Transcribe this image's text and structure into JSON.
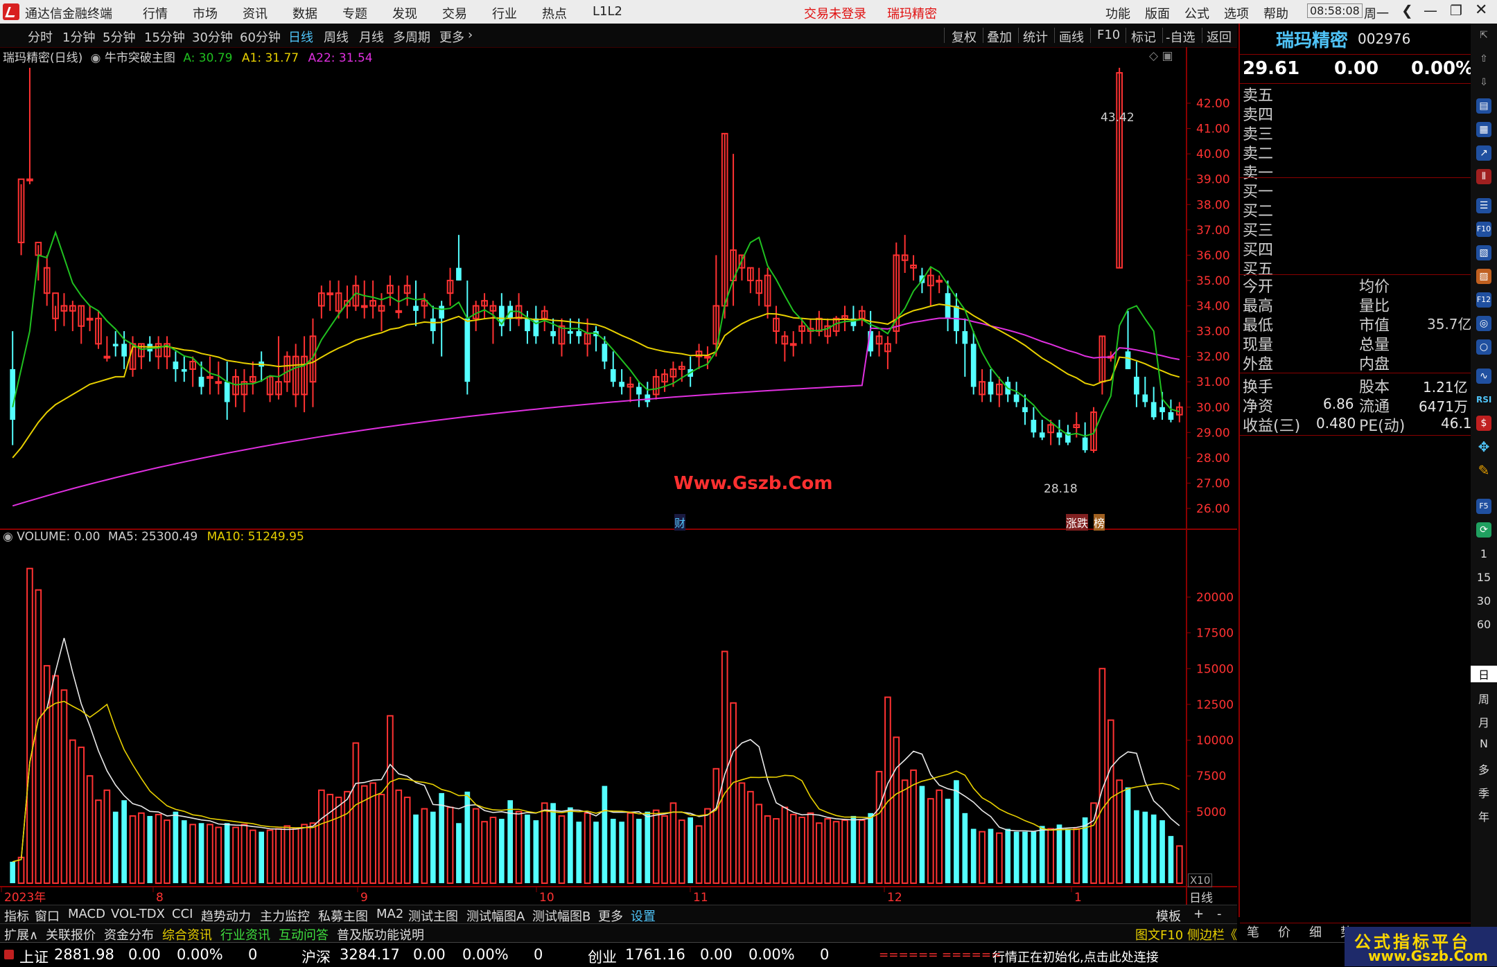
{
  "app": {
    "title": "通达信金融终端",
    "menu": [
      "行情",
      "市场",
      "资讯",
      "数据",
      "专题",
      "发现",
      "交易",
      "行业",
      "热点",
      "L1L2"
    ],
    "login_status": "交易未登录",
    "stock_name": "瑞玛精密",
    "right_menu": [
      "功能",
      "版面",
      "公式",
      "选项",
      "帮助"
    ],
    "time": "08:58:08",
    "weekday": "周一"
  },
  "period_bar": {
    "periods": [
      "分时",
      "1分钟",
      "5分钟",
      "15分钟",
      "30分钟",
      "60分钟",
      "日线",
      "周线",
      "月线",
      "多周期",
      "更多"
    ],
    "active": "日线",
    "tools": [
      "复权",
      "叠加",
      "统计",
      "画线",
      "F10",
      "标记",
      "-自选",
      "返回"
    ]
  },
  "main_chart": {
    "title": "瑞玛精密(日线)",
    "indicator": "牛市突破主图",
    "a_label": "A: 30.79",
    "a1_label": "A1: 31.77",
    "a22_label": "A22: 31.54",
    "y_ticks": [
      "42.00",
      "41.00",
      "40.00",
      "39.00",
      "38.00",
      "37.00",
      "36.00",
      "35.00",
      "34.00",
      "33.00",
      "32.00",
      "31.00",
      "30.00",
      "29.00",
      "28.00",
      "27.00",
      "26.00"
    ],
    "high_label": "43.42",
    "low_label": "28.18",
    "watermark": "Www.Gszb.Com",
    "marker_cai": "财",
    "marker_zhangdie": "涨跌",
    "marker_bang": "榜"
  },
  "volume_chart": {
    "title": "VOLUME: 0.00",
    "ma5_label": "MA5: 25300.49",
    "ma10_label": "MA10: 51249.95",
    "y_ticks": [
      "20000",
      "17500",
      "15000",
      "12500",
      "10000",
      "7500",
      "5000"
    ],
    "unit": "X10",
    "x_labels": [
      "2023年",
      "8",
      "9",
      "10",
      "11",
      "12",
      "1"
    ],
    "period_label": "日线"
  },
  "chart_data": {
    "type": "candlestick",
    "price_axis": [
      26.0,
      43.0
    ],
    "candles": [
      [
        31.5,
        33.0,
        28.5,
        29.5
      ],
      [
        36.5,
        38.8,
        36.0,
        39.0
      ],
      [
        39.0,
        43.4,
        38.8,
        39.0
      ],
      [
        36.0,
        36.4,
        35.0,
        36.5
      ],
      [
        34.5,
        36.0,
        34.0,
        35.5
      ],
      [
        33.5,
        34.0,
        33.0,
        34.5
      ],
      [
        33.8,
        34.5,
        33.2,
        34.0
      ],
      [
        33.8,
        34.2,
        33.0,
        34.0
      ],
      [
        33.2,
        34.0,
        32.5,
        34.0
      ],
      [
        33.5,
        34.0,
        33.0,
        33.5
      ],
      [
        32.5,
        33.8,
        32.3,
        33.5
      ],
      [
        32.0,
        32.8,
        31.8,
        32.0
      ],
      [
        32.5,
        33.0,
        32.0,
        32.4
      ],
      [
        32.5,
        33.0,
        31.5,
        32.0
      ],
      [
        31.5,
        32.8,
        31.2,
        32.5
      ],
      [
        32.0,
        32.5,
        31.5,
        32.5
      ],
      [
        32.5,
        32.8,
        31.8,
        32.2
      ],
      [
        32.0,
        32.8,
        31.5,
        32.5
      ],
      [
        32.0,
        32.8,
        31.5,
        32.5
      ],
      [
        31.8,
        32.2,
        31.0,
        31.5
      ],
      [
        31.5,
        32.0,
        31.0,
        31.4
      ],
      [
        31.5,
        32.0,
        30.8,
        31.8
      ],
      [
        31.2,
        31.8,
        30.5,
        30.8
      ],
      [
        31.2,
        32.0,
        30.5,
        31.2
      ],
      [
        31.0,
        31.8,
        30.5,
        31.0
      ],
      [
        31.0,
        31.8,
        29.5,
        30.2
      ],
      [
        30.5,
        31.5,
        30.0,
        31.2
      ],
      [
        30.5,
        31.5,
        29.8,
        31.0
      ],
      [
        31.0,
        31.8,
        30.5,
        31.2
      ],
      [
        31.8,
        32.2,
        31.0,
        31.6
      ],
      [
        30.5,
        31.2,
        30.2,
        31.2
      ],
      [
        30.5,
        32.8,
        30.3,
        31.0
      ],
      [
        31.0,
        32.2,
        30.6,
        32.0
      ],
      [
        30.5,
        32.5,
        30.0,
        32.0
      ],
      [
        30.5,
        32.8,
        29.8,
        32.0
      ],
      [
        31.0,
        33.5,
        30.0,
        32.8
      ],
      [
        34.0,
        34.8,
        33.5,
        34.5
      ],
      [
        34.5,
        35.0,
        33.8,
        34.5
      ],
      [
        33.8,
        35.0,
        33.5,
        34.5
      ],
      [
        34.0,
        34.8,
        33.5,
        34.2
      ],
      [
        34.0,
        35.2,
        33.8,
        34.8
      ],
      [
        34.0,
        35.0,
        33.5,
        34.0
      ],
      [
        34.0,
        35.0,
        33.5,
        34.2
      ],
      [
        33.8,
        34.5,
        33.0,
        34.0
      ],
      [
        34.5,
        35.2,
        34.0,
        34.8
      ],
      [
        33.8,
        34.8,
        33.5,
        33.8
      ],
      [
        34.5,
        35.2,
        34.0,
        34.8
      ],
      [
        34.0,
        35.0,
        33.2,
        33.8
      ],
      [
        34.0,
        34.5,
        33.5,
        34.2
      ],
      [
        33.5,
        34.0,
        32.5,
        33.0
      ],
      [
        34.0,
        34.2,
        32.0,
        33.5
      ],
      [
        34.5,
        35.5,
        34.0,
        35.0
      ],
      [
        35.5,
        36.8,
        35.0,
        35.0
      ],
      [
        33.5,
        35.0,
        30.5,
        31.0
      ],
      [
        33.5,
        34.2,
        33.0,
        34.0
      ],
      [
        34.0,
        34.5,
        33.5,
        34.2
      ],
      [
        33.8,
        34.2,
        32.5,
        34.0
      ],
      [
        34.0,
        34.5,
        32.8,
        33.2
      ],
      [
        34.0,
        34.2,
        33.0,
        33.5
      ],
      [
        33.5,
        34.5,
        33.2,
        34.0
      ],
      [
        33.5,
        33.8,
        32.5,
        33.0
      ],
      [
        33.5,
        34.0,
        32.5,
        32.8
      ],
      [
        33.5,
        34.0,
        33.0,
        33.8
      ],
      [
        33.0,
        33.5,
        32.5,
        32.8
      ],
      [
        32.5,
        33.5,
        32.0,
        33.2
      ],
      [
        33.0,
        33.5,
        32.5,
        32.9
      ],
      [
        33.0,
        33.5,
        32.5,
        32.8
      ],
      [
        32.5,
        33.5,
        32.0,
        32.9
      ],
      [
        33.0,
        33.2,
        32.2,
        32.8
      ],
      [
        32.5,
        32.8,
        31.5,
        31.8
      ],
      [
        31.5,
        32.2,
        30.8,
        31.0
      ],
      [
        31.0,
        31.5,
        30.5,
        30.8
      ],
      [
        30.8,
        31.2,
        30.2,
        30.9
      ],
      [
        30.8,
        31.0,
        30.0,
        30.5
      ],
      [
        30.5,
        31.0,
        30.0,
        30.2
      ],
      [
        30.5,
        31.5,
        30.3,
        31.2
      ],
      [
        31.0,
        31.5,
        30.6,
        31.3
      ],
      [
        31.2,
        31.8,
        30.8,
        31.5
      ],
      [
        31.5,
        31.8,
        31.0,
        31.6
      ],
      [
        31.5,
        32.0,
        30.8,
        31.2
      ],
      [
        32.0,
        32.5,
        31.5,
        32.2
      ],
      [
        32.0,
        32.4,
        31.5,
        32.0
      ],
      [
        32.5,
        36.0,
        32.0,
        34.0
      ],
      [
        34.0,
        40.8,
        33.5,
        40.8
      ],
      [
        35.0,
        40.0,
        34.0,
        36.2
      ],
      [
        35.5,
        36.0,
        35.0,
        36.0
      ],
      [
        35.0,
        35.5,
        34.5,
        35.5
      ],
      [
        34.5,
        35.5,
        34.0,
        35.0
      ],
      [
        34.0,
        35.5,
        33.5,
        35.2
      ],
      [
        33.0,
        34.0,
        32.5,
        33.5
      ],
      [
        32.5,
        33.0,
        31.8,
        32.8
      ],
      [
        32.5,
        33.0,
        32.0,
        32.5
      ],
      [
        33.0,
        33.5,
        32.5,
        33.2
      ],
      [
        33.0,
        33.5,
        32.5,
        33.1
      ],
      [
        33.0,
        33.8,
        32.8,
        33.5
      ],
      [
        32.8,
        33.5,
        32.5,
        33.2
      ],
      [
        33.0,
        33.6,
        32.8,
        33.5
      ],
      [
        33.5,
        34.0,
        33.0,
        33.6
      ],
      [
        33.5,
        34.0,
        33.0,
        33.2
      ],
      [
        33.5,
        34.0,
        33.2,
        33.8
      ],
      [
        33.0,
        33.8,
        32.0,
        32.2
      ],
      [
        32.5,
        33.0,
        32.0,
        32.8
      ],
      [
        32.2,
        32.8,
        31.5,
        32.5
      ],
      [
        33.0,
        36.5,
        32.5,
        36.0
      ],
      [
        35.8,
        36.8,
        35.3,
        36.0
      ],
      [
        35.5,
        36.0,
        35.0,
        35.6
      ],
      [
        35.2,
        35.5,
        34.5,
        34.9
      ],
      [
        34.8,
        35.5,
        34.0,
        35.2
      ],
      [
        35.0,
        35.2,
        34.5,
        35.0
      ],
      [
        34.5,
        35.0,
        33.0,
        33.5
      ],
      [
        34.0,
        34.5,
        32.5,
        33.0
      ],
      [
        33.0,
        33.5,
        31.2,
        32.5
      ],
      [
        32.5,
        33.0,
        30.5,
        30.8
      ],
      [
        30.5,
        31.5,
        30.2,
        31.0
      ],
      [
        31.0,
        31.5,
        30.2,
        30.5
      ],
      [
        30.5,
        31.2,
        30.0,
        30.9
      ],
      [
        31.0,
        31.2,
        30.2,
        30.5
      ],
      [
        30.5,
        31.0,
        30.0,
        30.2
      ],
      [
        30.0,
        30.5,
        29.3,
        29.8
      ],
      [
        29.5,
        30.0,
        28.8,
        29.0
      ],
      [
        29.0,
        29.5,
        28.7,
        28.8
      ],
      [
        29.0,
        29.5,
        28.5,
        29.3
      ],
      [
        29.0,
        29.5,
        28.5,
        28.8
      ],
      [
        29.0,
        29.3,
        28.5,
        28.6
      ],
      [
        29.2,
        29.8,
        28.8,
        29.3
      ],
      [
        28.8,
        29.4,
        28.2,
        28.3
      ],
      [
        28.3,
        30.0,
        28.2,
        29.8
      ],
      [
        31.0,
        32.8,
        30.5,
        32.8
      ],
      [
        32.0,
        32.2,
        31.8,
        32.0
      ],
      [
        35.5,
        43.4,
        35.5,
        43.2
      ],
      [
        32.2,
        33.8,
        31.5,
        31.5
      ],
      [
        31.2,
        31.8,
        30.0,
        30.5
      ],
      [
        30.5,
        31.2,
        30.0,
        30.2
      ],
      [
        30.2,
        30.8,
        29.5,
        29.6
      ],
      [
        30.0,
        30.6,
        29.5,
        29.8
      ],
      [
        29.8,
        30.3,
        29.4,
        29.5
      ],
      [
        29.7,
        30.2,
        29.4,
        30.0
      ]
    ],
    "volume_axis": [
      0,
      22000
    ],
    "volume": [
      1500,
      1800,
      22000,
      20500,
      15200,
      14500,
      13500,
      10000,
      9500,
      7500,
      5800,
      6500,
      5000,
      5800,
      4700,
      4900,
      4700,
      4800,
      4400,
      5000,
      4400,
      4100,
      4200,
      4100,
      3900,
      4200,
      3900,
      4100,
      3700,
      3600,
      3700,
      3800,
      4000,
      3800,
      4100,
      4200,
      6500,
      6200,
      6000,
      6400,
      9800,
      6800,
      7000,
      6200,
      11700,
      6500,
      6000,
      4800,
      5200,
      5000,
      6300,
      5300,
      4200,
      6400,
      5200,
      4300,
      4600,
      4500,
      5800,
      5000,
      4800,
      4400,
      5600,
      5600,
      4700,
      5300,
      4300,
      4900,
      4300,
      6800,
      4500,
      4300,
      4900,
      4500,
      5000,
      5100,
      4700,
      5600,
      4400,
      4600,
      4000,
      5200,
      8000,
      16200,
      12600,
      7000,
      6400,
      5500,
      4700,
      4500,
      5300,
      4800,
      4600,
      4900,
      4200,
      4500,
      4300,
      4400,
      4700,
      4400,
      4900,
      7800,
      13000,
      10200,
      7200,
      7900,
      6800,
      5900,
      6500,
      5900,
      7200,
      4900,
      3800,
      3600,
      3800,
      3500,
      3800,
      3600,
      3600,
      3600,
      4000,
      3800,
      4100,
      3800,
      3800,
      4600,
      5600,
      15000,
      11400,
      7200,
      6700,
      5100,
      5000,
      4800,
      4400,
      3300,
      2600
    ],
    "vol_ma5": [],
    "vol_ma10": []
  },
  "right_panel": {
    "name": "瑞玛精密",
    "code": "002976",
    "price": "29.61",
    "change": "0.00",
    "pct": "0.00%",
    "sell": [
      "卖五",
      "卖四",
      "卖三",
      "卖二",
      "卖一"
    ],
    "buy": [
      "买一",
      "买二",
      "买三",
      "买四",
      "买五"
    ],
    "stats_left": [
      "今开",
      "最高",
      "最低",
      "现量",
      "外盘"
    ],
    "stats_right": [
      "均价",
      "量比",
      "市值",
      "总量",
      "内盘"
    ],
    "market_cap": "35.7亿",
    "fin": [
      {
        "k": "换手",
        "v": "",
        "k2": "股本",
        "v2": "1.21亿"
      },
      {
        "k": "净资",
        "v": "6.86",
        "k2": "流通",
        "v2": "6471万"
      },
      {
        "k": "收益(三)",
        "v": "0.480",
        "k2": "PE(动)",
        "v2": "46.1"
      }
    ],
    "bottom_tabs": [
      "笔",
      "价",
      "细",
      "势"
    ]
  },
  "side_tools": {
    "numbers": [
      "1",
      "15",
      "30",
      "60"
    ],
    "periods": [
      "日",
      "周",
      "月",
      "N",
      "多",
      "季",
      "年"
    ],
    "rsi": "RSI"
  },
  "tabs_row1": [
    "指标",
    "窗口",
    "MACD",
    "VOL-TDX",
    "CCI",
    "趋势动力",
    "主力监控",
    "私募主图",
    "MA2",
    "测试主图",
    "测试幅图A",
    "测试幅图B",
    "更多",
    "设置"
  ],
  "tabs_row1_right": [
    "模板",
    "+",
    "-"
  ],
  "tabs_row2": [
    "扩展∧",
    "关联报价",
    "资金分布",
    "综合资讯",
    "行业资讯",
    "互动问答",
    "普及版功能说明"
  ],
  "tabs_row2_right": "图文F10 侧边栏《",
  "status_bar": {
    "idx1": {
      "name": "上证",
      "val": "2881.98",
      "chg": "0.00",
      "pct": "0.00%",
      "vol": "0"
    },
    "idx2": {
      "name": "沪深",
      "val": "3284.17",
      "chg": "0.00",
      "pct": "0.00%",
      "vol": "0"
    },
    "idx3": {
      "name": "创业",
      "val": "1761.16",
      "chg": "0.00",
      "pct": "0.00%",
      "vol": "0"
    },
    "bars": "====== ======",
    "msg": "行情正在初始化,点击此处连接"
  },
  "watermark": {
    "line1": "公式指标平台",
    "line2": "www.Gszb.Com"
  },
  "colors": {
    "up": "#ff3232",
    "down": "#54ffff",
    "ma_green": "#20c020",
    "ma_yellow": "#e8d000",
    "ma_magenta": "#e030e0",
    "frame": "#8b0000",
    "accent": "#4fc3f7"
  }
}
